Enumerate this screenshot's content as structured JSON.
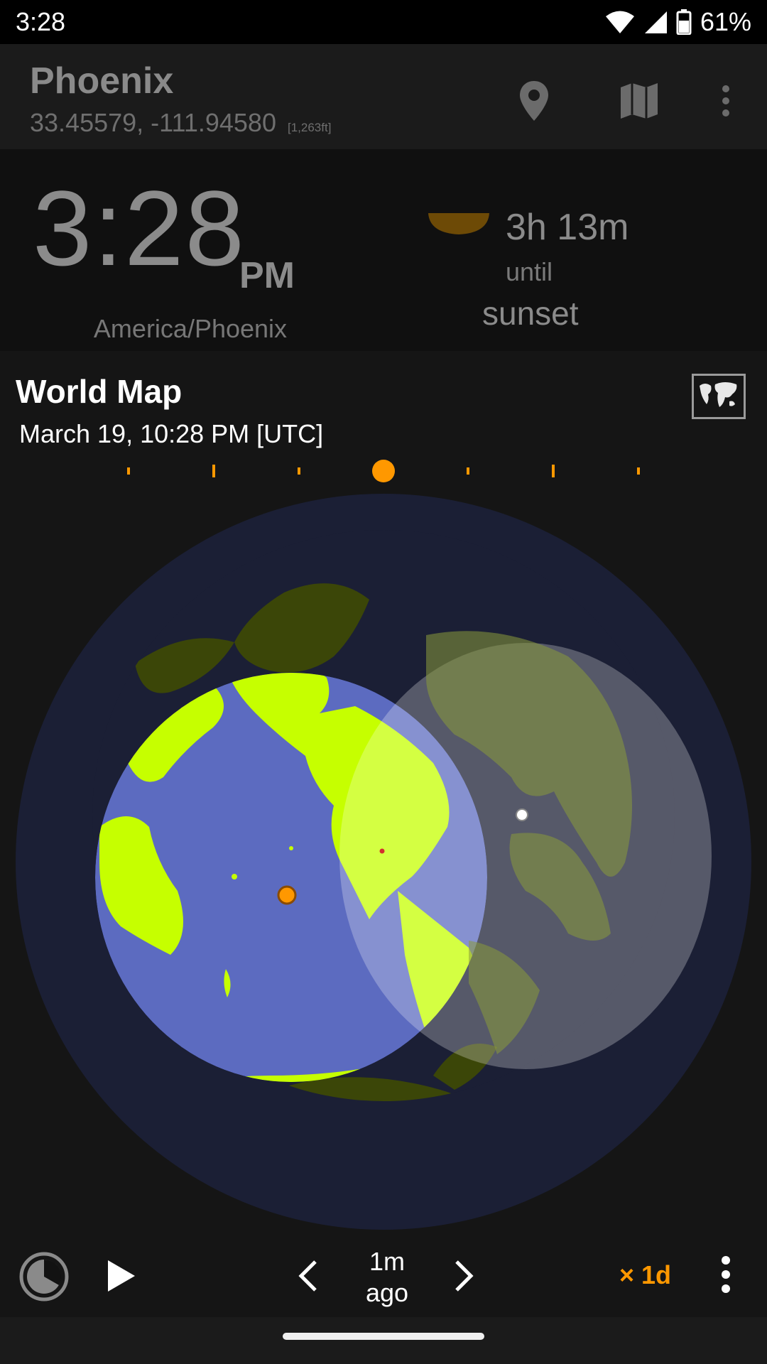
{
  "status_bar": {
    "time": "3:28",
    "battery": "61%"
  },
  "location": {
    "name": "Phoenix",
    "coords": "33.45579, -111.94580",
    "elevation": "[1,263ft]"
  },
  "clock": {
    "time": "3:28",
    "ampm": "PM",
    "timezone": "America/Phoenix"
  },
  "sunset": {
    "duration": "3h 13m",
    "until": "until",
    "event": "sunset"
  },
  "map": {
    "title": "World Map",
    "datetime": "March 19, 10:28 PM [UTC]"
  },
  "controls": {
    "ago_line1": "1m",
    "ago_line2": "ago",
    "speed": "× 1d"
  },
  "colors": {
    "accent": "#ff9800",
    "land_day": "#c6ff00",
    "ocean_day": "#5c6bc0",
    "space": "#1b1f35"
  },
  "icons": [
    "wifi-icon",
    "signal-icon",
    "battery-icon",
    "location-pin-icon",
    "map-icon",
    "more-vert-icon",
    "world-map-icon",
    "clock-icon",
    "play-icon",
    "chevron-left-icon",
    "chevron-right-icon"
  ]
}
